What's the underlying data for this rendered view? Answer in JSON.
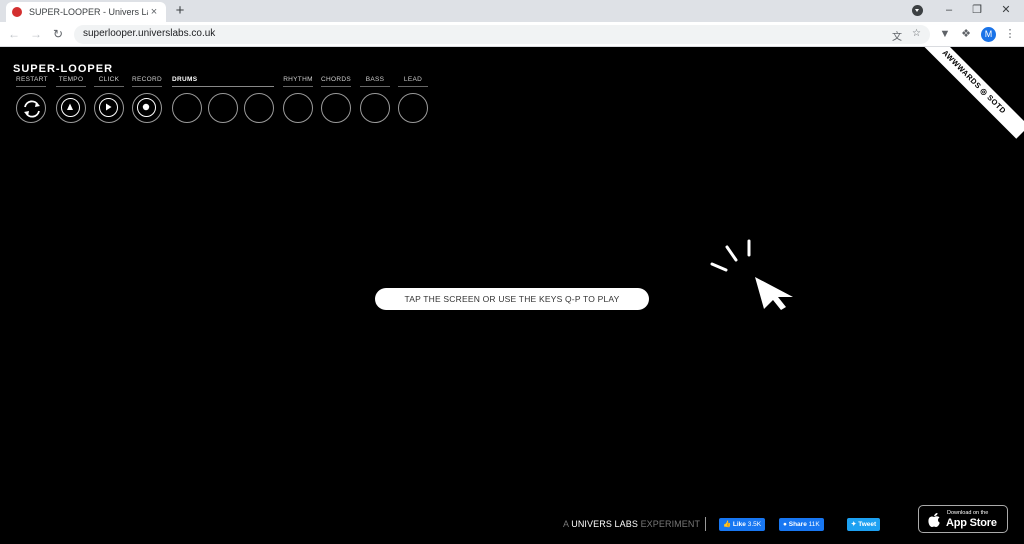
{
  "browser": {
    "tab_title": "SUPER-LOOPER - Univers Labs",
    "tab_close": "×",
    "new_tab": "+",
    "url": "superlooper.universlabs.co.uk",
    "avatar_initial": "M",
    "favicon_color": "#d32f2f"
  },
  "app": {
    "logo": "SUPER-LOOPER",
    "controls": [
      {
        "label": "RESTART",
        "icon": "restart-icon"
      },
      {
        "label": "TEMPO",
        "icon": "tempo-icon"
      },
      {
        "label": "CLICK",
        "icon": "play-icon"
      },
      {
        "label": "RECORD",
        "icon": "record-icon"
      }
    ],
    "instruments": {
      "drums": "DRUMS",
      "rhythm": "RHYTHM",
      "chords": "CHORDS",
      "bass": "BASS",
      "lead": "LEAD"
    },
    "tap_prompt": "TAP THE SCREEN OR USE THE KEYS Q-P TO PLAY",
    "awwwards": "AWWWARDS ◎ SOTD"
  },
  "footer": {
    "credit_a": "A",
    "credit_brand": "UNIVERS LABS",
    "credit_b": "EXPERIMENT",
    "like_label": "Like",
    "like_count": "3.5K",
    "share_label": "Share",
    "share_count": "11K",
    "tweet_label": "Tweet",
    "appstore_small": "Download on the",
    "appstore_big": "App Store"
  },
  "colors": {
    "background": "#000000",
    "facebook": "#1877f2",
    "twitter": "#1da1f2"
  }
}
